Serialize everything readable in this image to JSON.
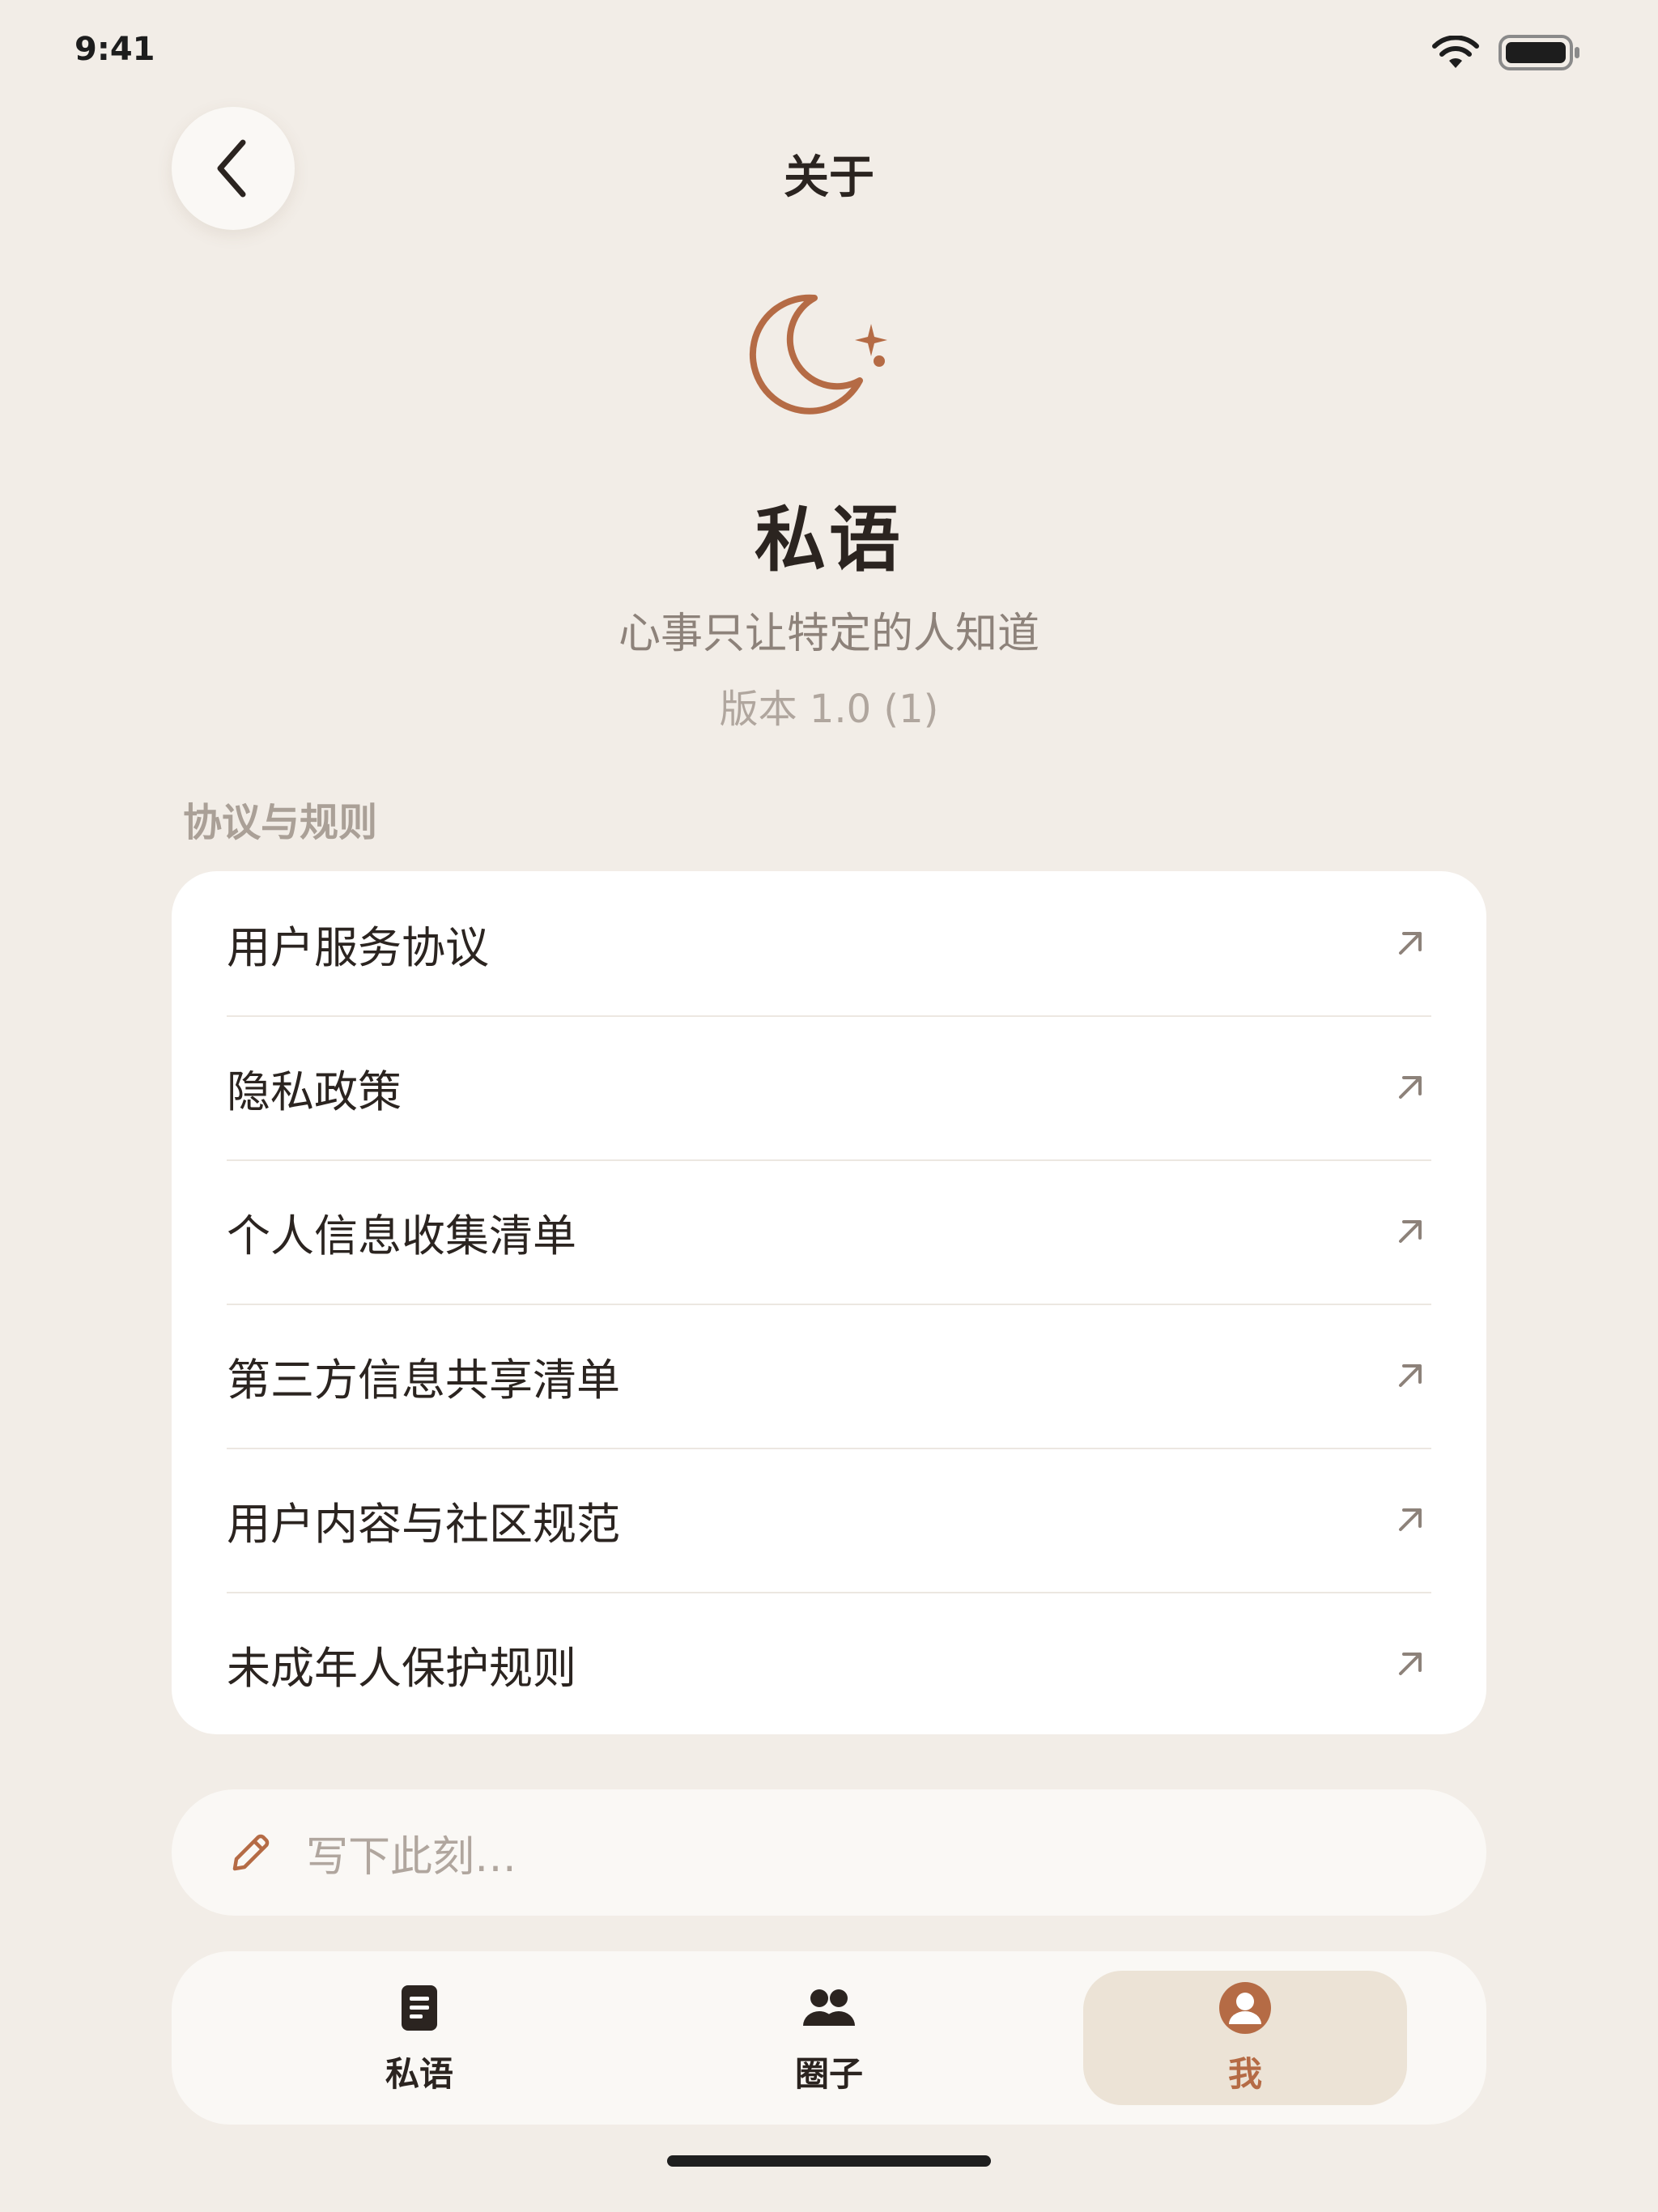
{
  "status_bar": {
    "time": "9:41"
  },
  "nav": {
    "title": "关于",
    "back_icon": "chevron-left-icon"
  },
  "app": {
    "name": "私语",
    "tagline": "心事只让特定的人知道",
    "version": "版本 1.0 (1)",
    "icon": "moon-star-icon"
  },
  "section": {
    "title": "协议与规则"
  },
  "links": [
    {
      "label": "用户服务协议",
      "icon": "external-arrow-icon"
    },
    {
      "label": "隐私政策",
      "icon": "external-arrow-icon"
    },
    {
      "label": "个人信息收集清单",
      "icon": "external-arrow-icon"
    },
    {
      "label": "第三方信息共享清单",
      "icon": "external-arrow-icon"
    },
    {
      "label": "用户内容与社区规范",
      "icon": "external-arrow-icon"
    },
    {
      "label": "未成年人保护规则",
      "icon": "external-arrow-icon"
    }
  ],
  "compose": {
    "placeholder": "写下此刻…",
    "icon": "pencil-icon"
  },
  "tabs": [
    {
      "label": "私语",
      "icon": "document-icon",
      "active": false
    },
    {
      "label": "圈子",
      "icon": "group-icon",
      "active": false
    },
    {
      "label": "我",
      "icon": "profile-icon",
      "active": true
    }
  ],
  "colors": {
    "accent": "#b56b45",
    "background": "#f2ede7",
    "card": "#ffffff"
  }
}
